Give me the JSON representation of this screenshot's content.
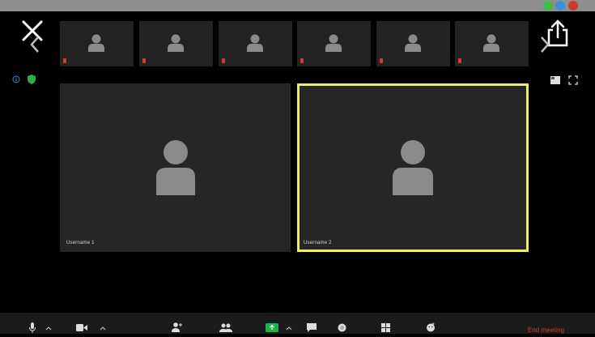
{
  "window": {
    "buttons": [
      "green",
      "blue",
      "red"
    ]
  },
  "colors": {
    "background": "#000000",
    "tile": "#262626",
    "thumb": "#232323",
    "active_speaker": "#f0ef59",
    "end": "#d23a2a",
    "share_green": "#22b14c"
  },
  "thumbnails": [
    {
      "muted": true
    },
    {
      "muted": true
    },
    {
      "muted": true
    },
    {
      "muted": true
    },
    {
      "muted": true
    },
    {
      "muted": true
    }
  ],
  "participants": [
    {
      "name": "Username 1",
      "active": false
    },
    {
      "name": "Username 2",
      "active": true
    }
  ],
  "icons": {
    "close": "close-icon",
    "share": "share-icon",
    "prev": "chevron-left-icon",
    "next": "chevron-right-icon",
    "info": "info-icon",
    "security": "shield-icon",
    "view": "speaker-view-icon",
    "fullscreen": "fullscreen-icon"
  },
  "toolbar": {
    "items": [
      "mute-icon",
      "video-icon",
      "invite-icon",
      "participants-icon",
      "share-screen-icon",
      "chat-icon",
      "record-icon",
      "apps-icon",
      "reactions-icon"
    ],
    "end_label": "End meeting"
  }
}
